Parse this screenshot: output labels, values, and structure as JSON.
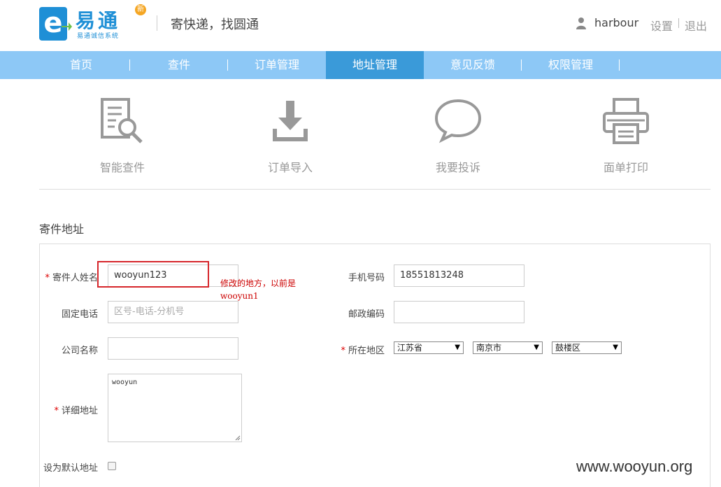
{
  "header": {
    "logo_name": "易通",
    "logo_sub": "易通诚信系统",
    "logo_badge": "新",
    "slogan": "寄快递，找圆通",
    "username": "harbour",
    "settings": "设置",
    "logout": "退出"
  },
  "nav": {
    "items": [
      {
        "label": "首页"
      },
      {
        "label": "查件"
      },
      {
        "label": "订单管理"
      },
      {
        "label": "地址管理"
      },
      {
        "label": "意见反馈"
      },
      {
        "label": "权限管理"
      }
    ],
    "active_index": 3
  },
  "features": [
    {
      "label": "智能查件",
      "icon": "document-search-icon"
    },
    {
      "label": "订单导入",
      "icon": "download-icon"
    },
    {
      "label": "我要投诉",
      "icon": "speech-bubble-icon"
    },
    {
      "label": "面单打印",
      "icon": "printer-icon"
    }
  ],
  "form": {
    "section_title": "寄件地址",
    "sender_name_label": "寄件人姓名",
    "sender_name_value": "wooyun123",
    "mobile_label": "手机号码",
    "mobile_value": "18551813248",
    "landline_label": "固定电话",
    "landline_placeholder": "区号-电话-分机号",
    "postcode_label": "邮政编码",
    "company_label": "公司名称",
    "region_label": "所在地区",
    "province": "江苏省",
    "city": "南京市",
    "district": "鼓楼区",
    "address_label": "详细地址",
    "address_value": "wooyun",
    "default_label": "设为默认地址",
    "required_mark": "*"
  },
  "annotation": {
    "line1": "修改的地方，以前是",
    "line2": "wooyun1"
  },
  "watermark": "www.wooyun.org",
  "colors": {
    "nav_bg": "#8dc8f6",
    "nav_active": "#3a9ad9",
    "brand": "#1e8fd6",
    "highlight": "#d6262b"
  }
}
